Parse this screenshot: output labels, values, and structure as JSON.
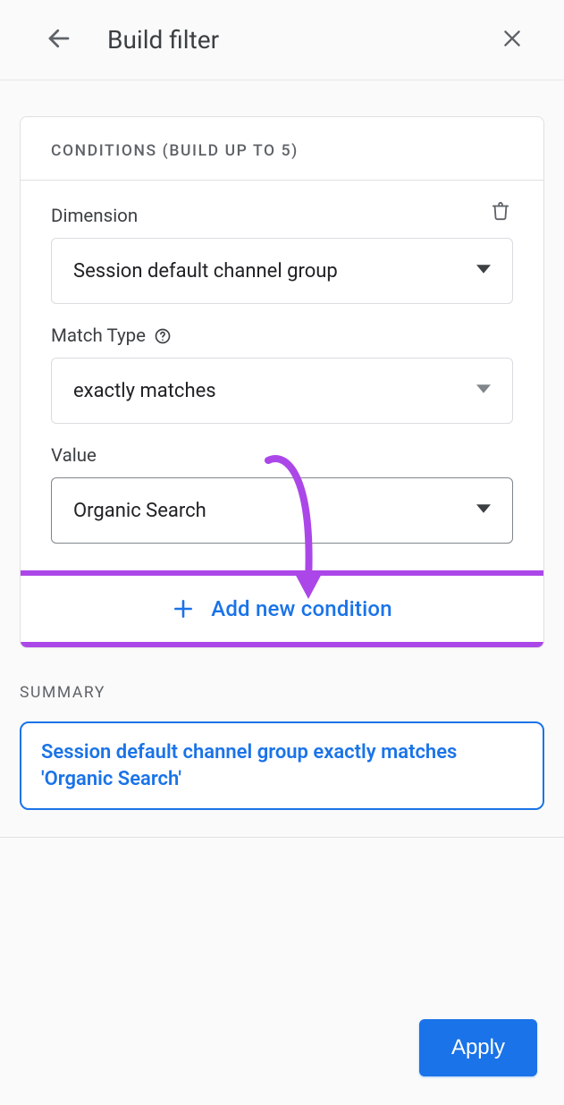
{
  "colors": {
    "accent": "#1a73e8",
    "annotation": "#ab47e8"
  },
  "header": {
    "title": "Build filter"
  },
  "conditions_section": {
    "title": "Conditions (build up to 5)",
    "max": 5,
    "items": [
      {
        "dimension_label": "Dimension",
        "dimension_value": "Session default channel group",
        "match_type_label": "Match Type",
        "match_type_value": "exactly matches",
        "value_label": "Value",
        "value_value": "Organic Search"
      }
    ],
    "add_new_label": "Add new condition"
  },
  "summary": {
    "label": "Summary",
    "text": "Session default channel group exactly matches 'Organic Search'"
  },
  "footer": {
    "apply_label": "Apply"
  },
  "icons": {
    "back": "arrow-left",
    "close": "x",
    "delete": "trash",
    "help": "help-circle",
    "caret": "triangle-down",
    "plus": "plus"
  }
}
